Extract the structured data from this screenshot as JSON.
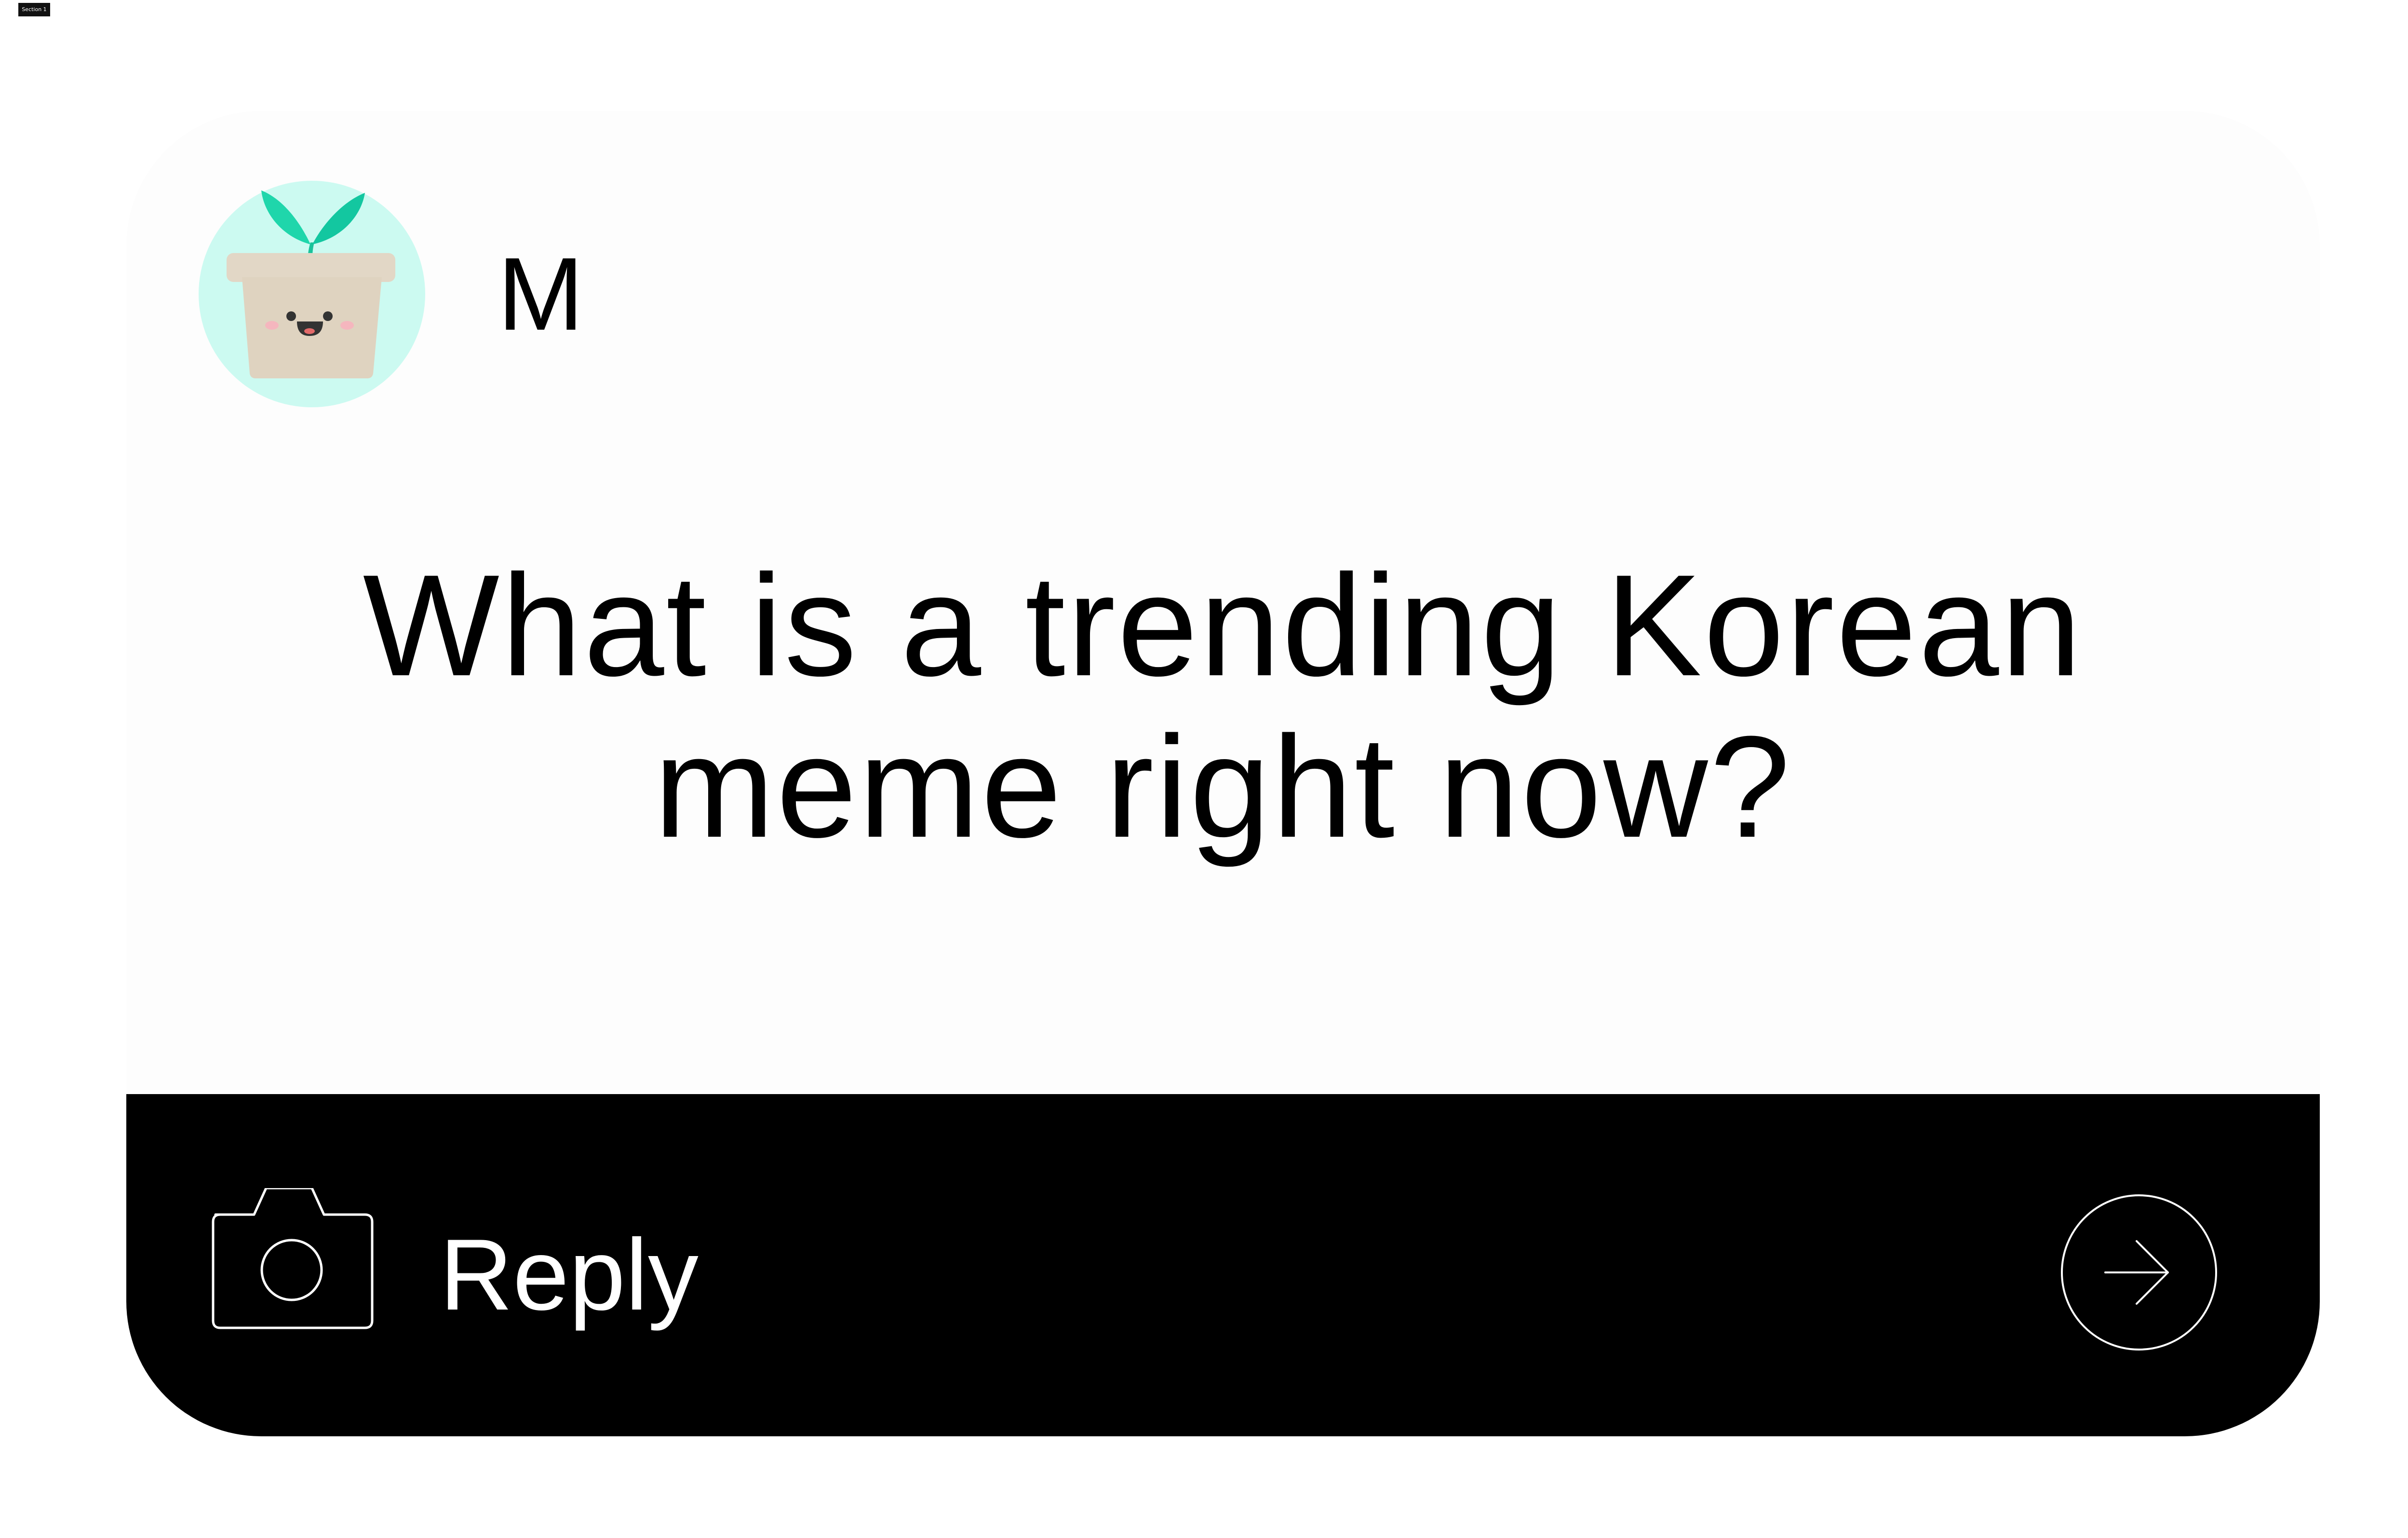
{
  "section_tag": "Section 1",
  "post": {
    "author": "M",
    "avatar_icon": "plant-pot-avatar-icon",
    "question": "What is a trending Korean meme right now?"
  },
  "reply_bar": {
    "camera_icon": "camera-icon",
    "placeholder": "Reply",
    "send_icon": "arrow-right-icon"
  },
  "colors": {
    "card_background": "#fdfdfd",
    "reply_bar_background": "#000000",
    "avatar_circle": "#ccfaf1",
    "leaf": "#1fd6ab",
    "pot": "#e2d7c6",
    "text": "#000000",
    "reply_text": "#ffffff"
  }
}
